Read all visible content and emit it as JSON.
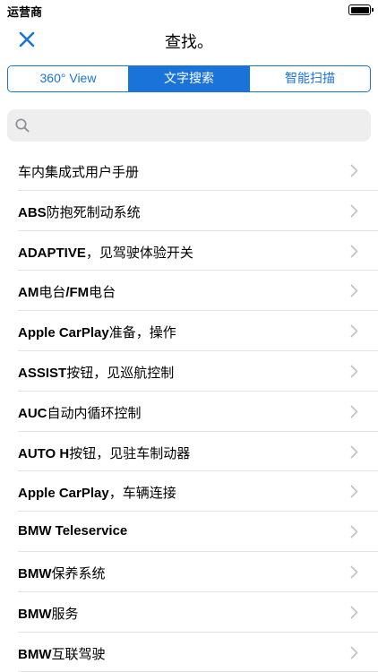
{
  "status_bar": {
    "carrier": "运营商"
  },
  "nav": {
    "title": "查找。"
  },
  "segments": [
    {
      "label": "360° View",
      "active": false
    },
    {
      "label": "文字搜索",
      "active": true
    },
    {
      "label": "智能扫描",
      "active": false
    }
  ],
  "search": {
    "value": "",
    "placeholder": ""
  },
  "list": [
    {
      "bold": "",
      "rest": "车内集成式用户手册"
    },
    {
      "bold": "ABS",
      "rest": "防抱死制动系统"
    },
    {
      "bold": "ADAPTIVE",
      "rest": "，见驾驶体验开关"
    },
    {
      "bold": "AM",
      "rest": "电台",
      "bold2": "/FM",
      "rest2": "电台"
    },
    {
      "bold": "Apple CarPlay",
      "rest": "准备，操作"
    },
    {
      "bold": "ASSIST",
      "rest": "按钮，见巡航控制"
    },
    {
      "bold": "AUC",
      "rest": "自动内循环控制"
    },
    {
      "bold": "AUTO H",
      "rest": "按钮，见驻车制动器"
    },
    {
      "bold": "Apple CarPlay",
      "rest": "，车辆连接"
    },
    {
      "bold": "BMW Teleservice",
      "rest": ""
    },
    {
      "bold": "BMW",
      "rest": "保养系统"
    },
    {
      "bold": "BMW",
      "rest": "服务"
    },
    {
      "bold": "BMW",
      "rest": "互联驾驶"
    }
  ],
  "icons": {
    "close": "close-icon",
    "search": "search-icon",
    "chevron": "chevron-right-icon",
    "battery": "battery-icon"
  },
  "colors": {
    "accent": "#1a73d9",
    "search_bg": "#eeeeef",
    "chevron": "#c4c4c7",
    "separator": "#e3e3e6"
  }
}
